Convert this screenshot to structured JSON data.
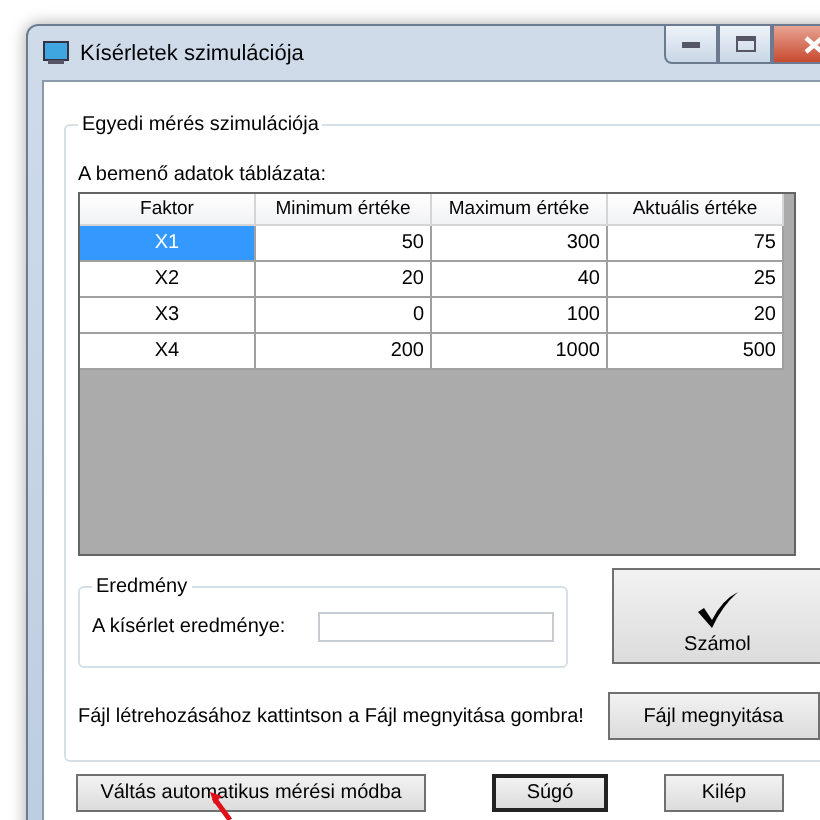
{
  "window": {
    "title": "Kísérletek szimulációja"
  },
  "group": {
    "title": "Egyedi mérés szimulációja"
  },
  "table": {
    "label": "A bemenő adatok táblázata:",
    "columns": [
      "Faktor",
      "Minimum értéke",
      "Maximum értéke",
      "Aktuális értéke"
    ],
    "rows": [
      {
        "cells": [
          "X1",
          "50",
          "300",
          "75"
        ],
        "selected": true
      },
      {
        "cells": [
          "X2",
          "20",
          "40",
          "25"
        ],
        "selected": false
      },
      {
        "cells": [
          "X3",
          "0",
          "100",
          "20"
        ],
        "selected": false
      },
      {
        "cells": [
          "X4",
          "200",
          "1000",
          "500"
        ],
        "selected": false
      }
    ]
  },
  "result": {
    "title": "Eredmény",
    "label": "A kísérlet eredménye:"
  },
  "calculate_button": {
    "label": "Számol"
  },
  "file_hint": "Fájl létrehozásához kattintson a Fájl megnyitása gombra!",
  "open_file_button": {
    "label": "Fájl megnyitása"
  },
  "bottom_buttons": [
    {
      "label": "Váltás automatikus mérési módba",
      "default": false
    },
    {
      "label": "Súgó",
      "default": true
    },
    {
      "label": "Kilép",
      "default": false
    }
  ]
}
